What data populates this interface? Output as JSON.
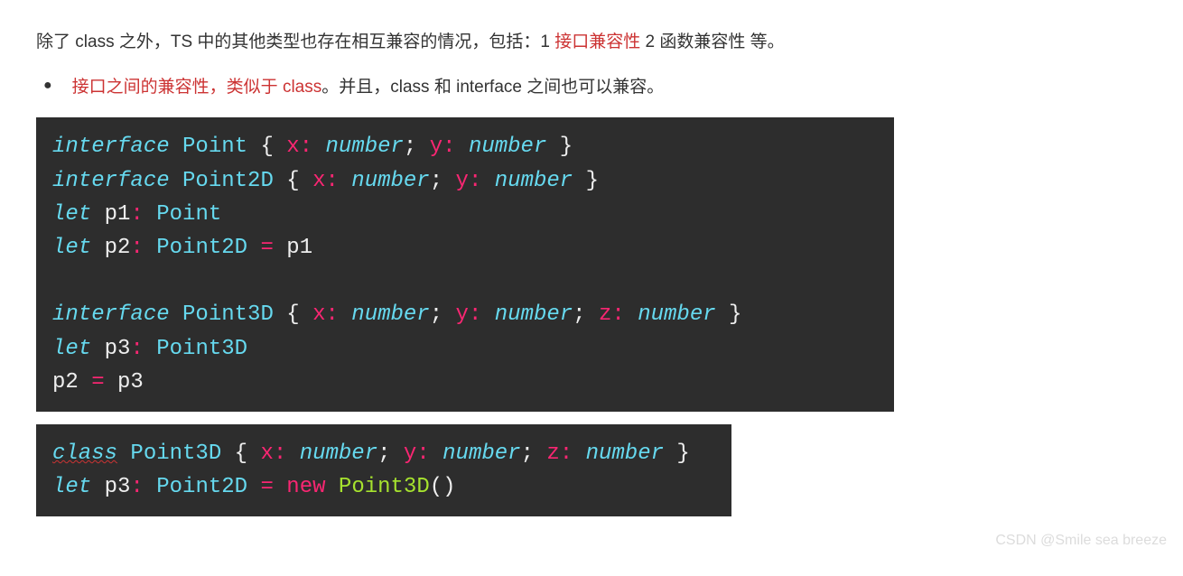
{
  "paragraph": {
    "p1": "除了 class 之外，TS 中的其他类型也存在相互兼容的情况，包括：1 ",
    "hl1": "接口兼容性",
    "p2": " 2 函数兼容性 等。"
  },
  "bullet": {
    "hl1": "接口之间的兼容性，类似于 class",
    "rest": "。并且，class 和 interface 之间也可以兼容。"
  },
  "code1": {
    "l1": {
      "kw": "interface",
      "name": "Point",
      "p1": "x",
      "t1": "number",
      "p2": "y",
      "t2": "number"
    },
    "l2": {
      "kw": "interface",
      "name": "Point2D",
      "p1": "x",
      "t1": "number",
      "p2": "y",
      "t2": "number"
    },
    "l3": {
      "kw": "let",
      "var": "p1",
      "type": "Point"
    },
    "l4": {
      "kw": "let",
      "var": "p2",
      "type": "Point2D",
      "rhs": "p1"
    },
    "l6": {
      "kw": "interface",
      "name": "Point3D",
      "p1": "x",
      "t1": "number",
      "p2": "y",
      "t2": "number",
      "p3": "z",
      "t3": "number"
    },
    "l7": {
      "kw": "let",
      "var": "p3",
      "type": "Point3D"
    },
    "l8": {
      "lhs": "p2",
      "rhs": "p3"
    }
  },
  "code2": {
    "l1": {
      "kw": "class",
      "name": "Point3D",
      "p1": "x",
      "t1": "number",
      "p2": "y",
      "t2": "number",
      "p3": "z",
      "t3": "number"
    },
    "l2": {
      "kw": "let",
      "var": "p3",
      "type": "Point2D",
      "newkw": "new",
      "ctor": "Point3D"
    }
  },
  "watermark": "CSDN @Smile sea breeze"
}
